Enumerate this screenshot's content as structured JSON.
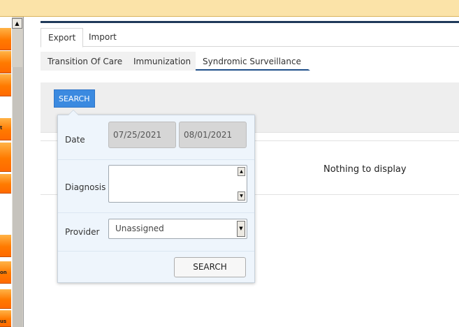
{
  "sidebar": {
    "labels": [
      "t",
      "on",
      "us"
    ]
  },
  "tabs_primary": [
    {
      "label": "Export",
      "active": true
    },
    {
      "label": "Import",
      "active": false
    }
  ],
  "tabs_secondary": [
    {
      "label": "Transition Of Care",
      "active": false
    },
    {
      "label": "Immunization",
      "active": false
    },
    {
      "label": "Syndromic Surveillance",
      "active": true
    }
  ],
  "search_button_label": "SEARCH",
  "results": {
    "empty_message": "Nothing to display"
  },
  "popup": {
    "date_label": "Date",
    "date_from": "07/25/2021",
    "date_to": "08/01/2021",
    "diagnosis_label": "Diagnosis",
    "diagnosis_value": "",
    "provider_label": "Provider",
    "provider_value": "Unassigned",
    "search_label": "SEARCH"
  },
  "colors": {
    "accent": "#3b8ae0",
    "sidebar_orange": "#ff7a00",
    "top_bar": "#fbe3a8",
    "tab_underline": "#1f4f8a"
  }
}
